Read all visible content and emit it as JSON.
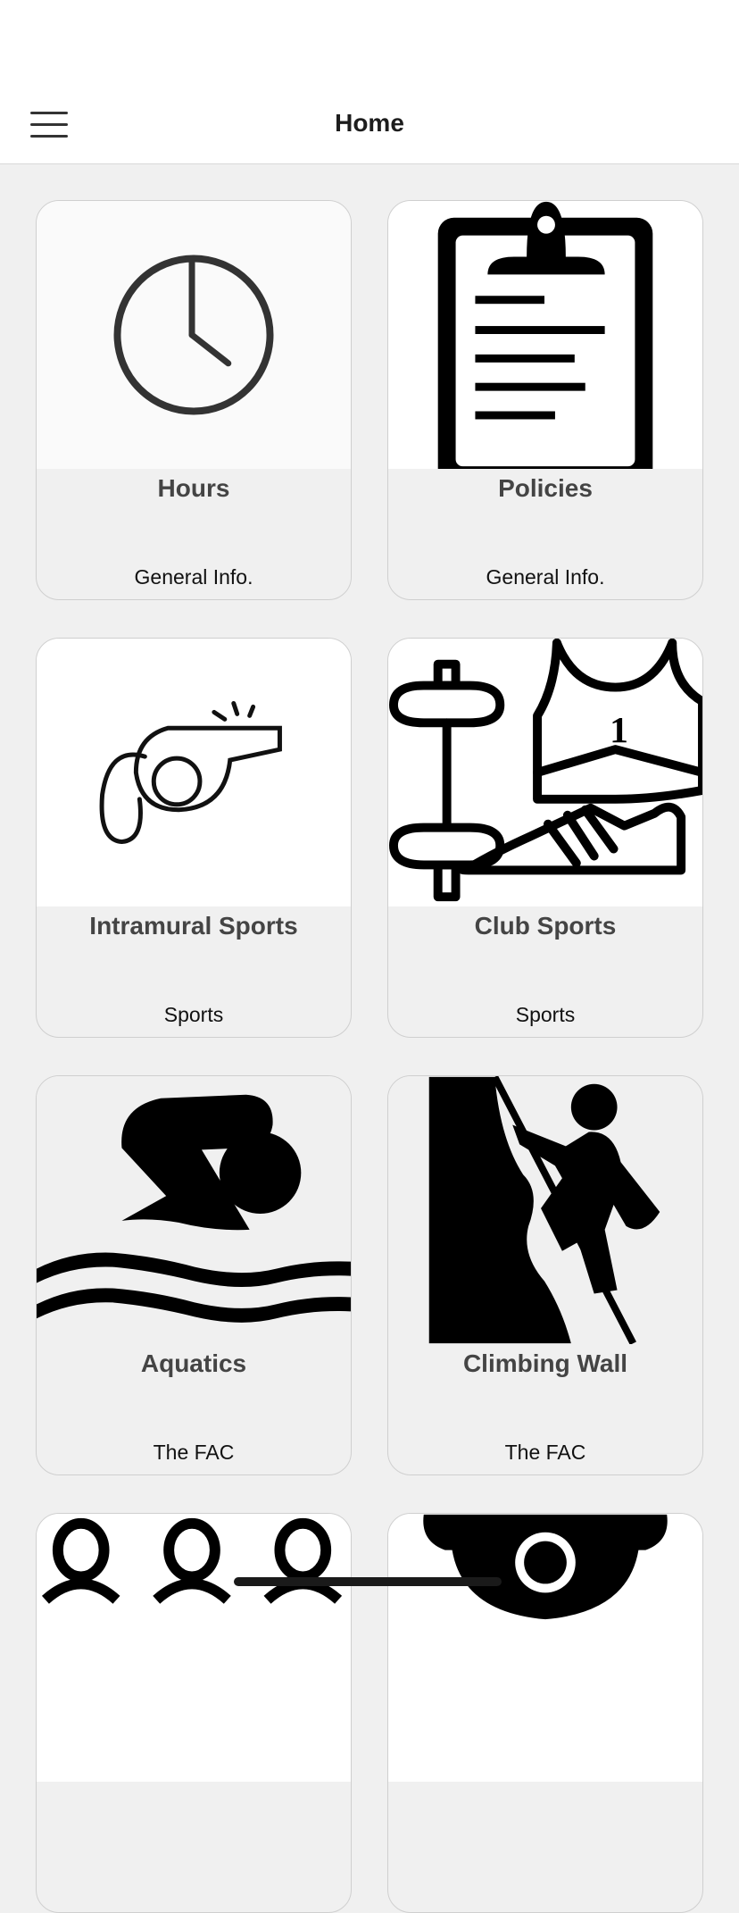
{
  "header": {
    "title": "Home",
    "menu_icon": "hamburger-menu-icon"
  },
  "cards": [
    {
      "title": "Hours",
      "category": "General Info.",
      "icon": "clock-icon"
    },
    {
      "title": "Policies",
      "category": "General Info.",
      "icon": "clipboard-icon"
    },
    {
      "title": "Intramural Sports",
      "category": "Sports",
      "icon": "whistle-icon"
    },
    {
      "title": "Club Sports",
      "category": "Sports",
      "icon": "club-sports-icon"
    },
    {
      "title": "Aquatics",
      "category": "The FAC",
      "icon": "swimmer-icon"
    },
    {
      "title": "Climbing Wall",
      "category": "The FAC",
      "icon": "climber-icon"
    },
    {
      "title": "",
      "category": "",
      "icon": "group-icon"
    },
    {
      "title": "",
      "category": "",
      "icon": "trophy-icon"
    }
  ]
}
